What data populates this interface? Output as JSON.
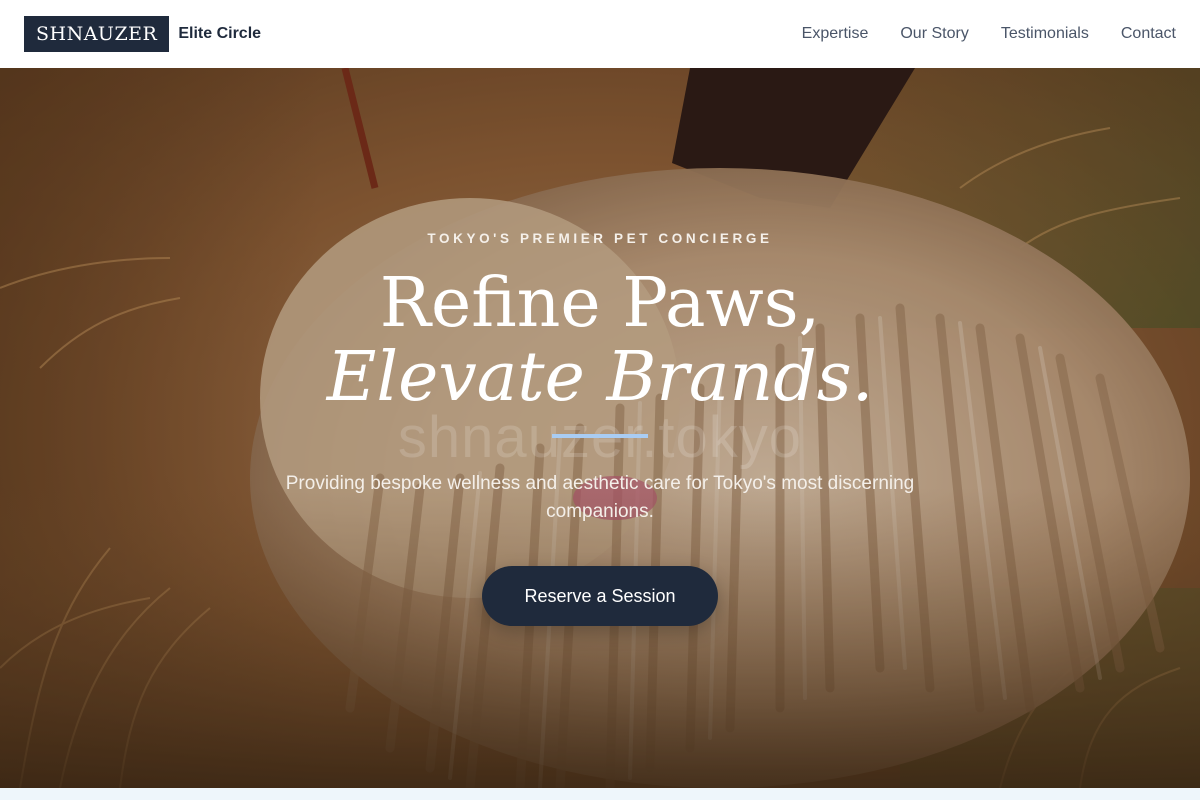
{
  "header": {
    "brand_name": "SHNAUZER",
    "brand_tagline": "Elite Circle",
    "nav": [
      {
        "label": "Expertise"
      },
      {
        "label": "Our Story"
      },
      {
        "label": "Testimonials"
      },
      {
        "label": "Contact"
      }
    ]
  },
  "hero": {
    "eyebrow": "TOKYO'S PREMIER PET CONCIERGE",
    "headline_line1": "Refine Paws,",
    "headline_line2": "Elevate Brands.",
    "watermark": "shnauzer.tokyo",
    "subcopy": "Providing bespoke wellness and aesthetic care for Tokyo's most discerning companions.",
    "cta_label": "Reserve a Session",
    "background_icon": "corded-dog-photo"
  },
  "colors": {
    "brand_navy": "#1f2a3c",
    "accent_blue": "#a9ccf2",
    "header_bg": "#ffffff"
  }
}
